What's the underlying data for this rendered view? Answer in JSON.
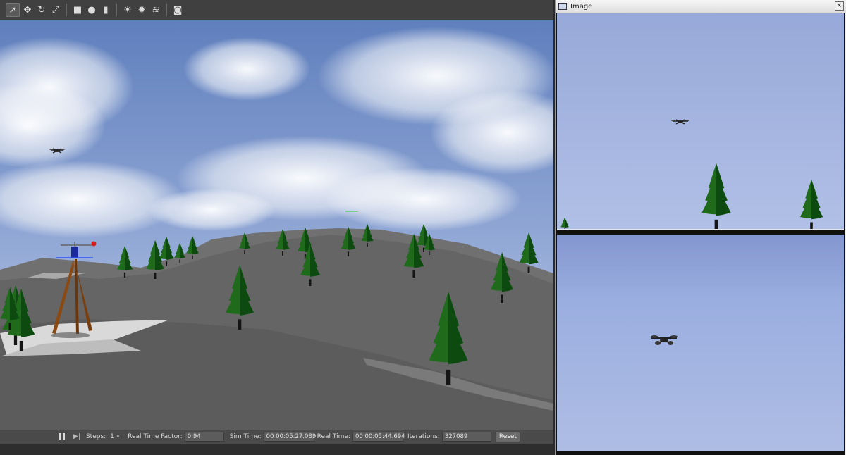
{
  "toolbar": {
    "tools": [
      {
        "name": "select-mode-icon",
        "glyph": "➚",
        "active": true
      },
      {
        "name": "translate-mode-icon",
        "glyph": "✥"
      },
      {
        "name": "rotate-mode-icon",
        "glyph": "↻"
      },
      {
        "name": "scale-mode-icon",
        "glyph": "⤢"
      },
      {
        "name": "box-shape-icon",
        "glyph": "■"
      },
      {
        "name": "sphere-shape-icon",
        "glyph": "●"
      },
      {
        "name": "cylinder-shape-icon",
        "glyph": "▮"
      },
      {
        "name": "point-light-icon",
        "glyph": "☀"
      },
      {
        "name": "spot-light-icon",
        "glyph": "✹"
      },
      {
        "name": "directional-light-icon",
        "glyph": "≋"
      },
      {
        "name": "screenshot-icon",
        "glyph": "◙"
      }
    ]
  },
  "status": {
    "steps_label": "Steps:",
    "steps_value": "1",
    "rtf_label": "Real Time Factor:",
    "rtf_value": "0.94",
    "sim_time_label": "Sim Time:",
    "sim_time_value": "00 00:05:27.089",
    "real_time_label": "Real Time:",
    "real_time_value": "00 00:05:44.694",
    "iterations_label": "Iterations:",
    "iterations_value": "327089",
    "reset_label": "Reset"
  },
  "image_window": {
    "title": "Image",
    "close_glyph": "×"
  },
  "colors": {
    "sky_top": "#6f8bc2",
    "sky_bottom": "#c9d6ec",
    "terrain": "#6e6e6e",
    "tree": "#1f6b1c",
    "trunk": "#151515",
    "tower": "#8b4a13",
    "camera_sky": "#9fb2dd"
  }
}
